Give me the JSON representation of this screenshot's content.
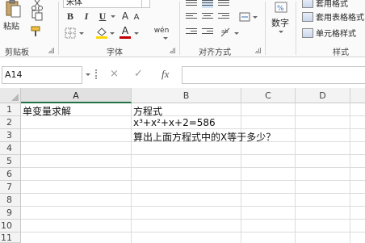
{
  "ribbon": {
    "clipboard": {
      "paste_label": "粘贴",
      "group_label": "剪贴板"
    },
    "font": {
      "font_name": "宋体",
      "bold": "B",
      "italic": "I",
      "underline": "U",
      "phonetic": "wén",
      "group_label": "字体",
      "font_color": "#c00000",
      "highlight_color": "#ffd700"
    },
    "alignment": {
      "group_label": "对齐方式"
    },
    "number": {
      "label": "数字"
    },
    "styles": {
      "items": [
        "套用格式",
        "套用表格格式",
        "单元格样式"
      ],
      "group_label": "样式"
    }
  },
  "formula_bar": {
    "name_box": "A14",
    "cancel_icon": "×",
    "enter_icon": "✓",
    "fx_label": "fx",
    "formula": ""
  },
  "grid": {
    "columns": [
      "A",
      "B",
      "C",
      "D"
    ],
    "selected_column": "A",
    "rows": [
      "1",
      "2",
      "3",
      "4",
      "5",
      "6",
      "7",
      "8",
      "9",
      "10",
      "11"
    ],
    "cells": {
      "A1": "单变量求解",
      "B1": "方程式",
      "B2": "x³+x²+x+2=586",
      "B3": "算出上面方程式中的X等于多少？"
    }
  }
}
